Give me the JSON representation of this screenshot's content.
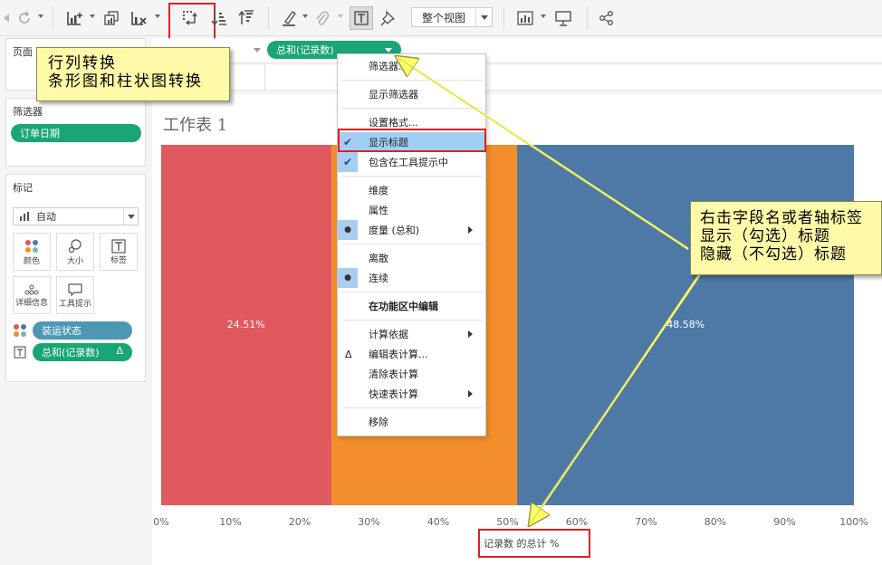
{
  "toolbar": {
    "view_select": "整个视图"
  },
  "left_panel": {
    "pages_title": "页面",
    "filters_title": "筛选器",
    "filter_pill": "订单日期",
    "marks_title": "标记",
    "marks_type": "自动",
    "mark_buttons": [
      "颜色",
      "大小",
      "标签",
      "详细信息",
      "工具提示"
    ],
    "color_pill": "装运状态",
    "label_pill": "总和(记录数)",
    "label_pill_delta": "Δ"
  },
  "shelf": {
    "pill": "总和(记录数)"
  },
  "sheet": {
    "title": "工作表 1",
    "axis_title": "记录数 的总计 %"
  },
  "chart_data": {
    "type": "bar",
    "orientation": "horizontal-stacked",
    "segments": [
      {
        "label": "24.51%",
        "value": 24.51,
        "color": "#e0595e"
      },
      {
        "label": "",
        "value": 26.91,
        "color": "#f28e2c"
      },
      {
        "label": "48.58%",
        "value": 48.58,
        "color": "#4e79a7"
      }
    ],
    "x_ticks": [
      "0%",
      "10%",
      "20%",
      "30%",
      "40%",
      "50%",
      "60%",
      "70%",
      "80%",
      "90%",
      "100%"
    ],
    "xlim": [
      0,
      100
    ],
    "xlabel": "记录数 的总计 %"
  },
  "context_menu": {
    "items": [
      {
        "label": "筛选器...",
        "checked": false,
        "dot": false,
        "submenu": false
      },
      {
        "label": "显示筛选器",
        "checked": false,
        "dot": false,
        "submenu": false
      },
      {
        "label": "设置格式...",
        "checked": false,
        "dot": false,
        "submenu": false
      },
      {
        "label": "显示标题",
        "checked": true,
        "dot": false,
        "submenu": false,
        "highlight": true
      },
      {
        "label": "包含在工具提示中",
        "checked": true,
        "dot": false,
        "submenu": false
      },
      {
        "label": "维度",
        "checked": false,
        "dot": false,
        "submenu": false
      },
      {
        "label": "属性",
        "checked": false,
        "dot": false,
        "submenu": false
      },
      {
        "label": "度量 (总和)",
        "checked": false,
        "dot": true,
        "submenu": true
      },
      {
        "label": "离散",
        "checked": false,
        "dot": false,
        "submenu": false
      },
      {
        "label": "连续",
        "checked": false,
        "dot": true,
        "submenu": false
      },
      {
        "label": "在功能区中编辑",
        "checked": false,
        "dot": false,
        "submenu": false,
        "bold": true
      },
      {
        "label": "计算依据",
        "checked": false,
        "dot": false,
        "submenu": true
      },
      {
        "label": "编辑表计算...",
        "checked": false,
        "dot": false,
        "submenu": false,
        "delta": true
      },
      {
        "label": "清除表计算",
        "checked": false,
        "dot": false,
        "submenu": false
      },
      {
        "label": "快速表计算",
        "checked": false,
        "dot": false,
        "submenu": true
      },
      {
        "label": "移除",
        "checked": false,
        "dot": false,
        "submenu": false
      }
    ]
  },
  "callouts": {
    "left_line1": "行列转换",
    "left_line2": "条形图和柱状图转换",
    "right_line1": "右击字段名或者轴标签",
    "right_line2": "显示（勾选）标题",
    "right_line3": "隐藏（不勾选）标题"
  }
}
